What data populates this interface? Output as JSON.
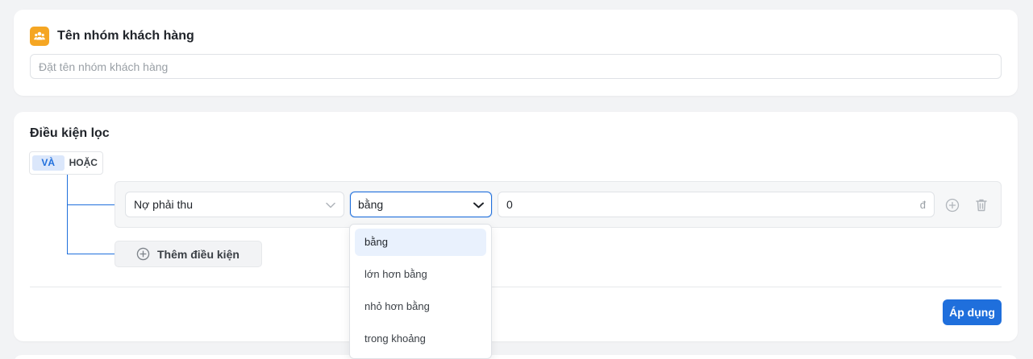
{
  "group_card": {
    "title": "Tên nhóm khách hàng",
    "name_placeholder": "Đặt tên nhóm khách hàng",
    "icon": "group-icon",
    "icon_color": "#f5a623"
  },
  "filter_card": {
    "title": "Điều kiện lọc",
    "logic": {
      "and_label": "VÀ",
      "or_label": "HOẶC",
      "selected": "VÀ"
    },
    "condition": {
      "field": "Nợ phải thu",
      "operator": "bằng",
      "value": "0",
      "unit": "đ"
    },
    "add_condition_label": "Thêm điều kiện",
    "apply_label": "Áp dụng",
    "operator_options": [
      "bằng",
      "lớn hơn bằng",
      "nhỏ hơn bằng",
      "trong khoảng"
    ],
    "selected_option_index": 0
  },
  "colors": {
    "accent": "#1f6fdc",
    "selected_option_bg": "#e9f1fd",
    "background": "#f2f3f5"
  }
}
